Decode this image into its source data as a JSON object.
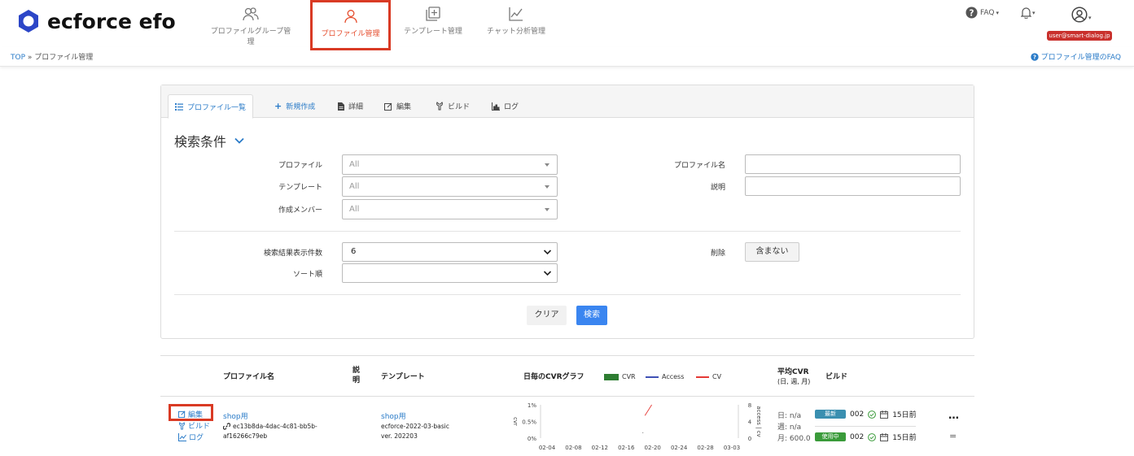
{
  "header": {
    "logo_text": "ecforce efo",
    "nav": [
      {
        "label": "プロファイルグループ管理",
        "active": false
      },
      {
        "label": "プロファイル管理",
        "active": true
      },
      {
        "label": "テンプレート管理",
        "active": false
      },
      {
        "label": "チャット分析管理",
        "active": false
      }
    ],
    "faq_label": "FAQ",
    "user_email": "user@smart-dialog.jp"
  },
  "breadcrumb": {
    "home": "TOP",
    "separator": "»",
    "current": "プロファイル管理"
  },
  "help_link": "プロファイル管理のFAQ",
  "tabs": [
    {
      "label": "プロファイル一覧",
      "icon": "list-icon",
      "active": true
    },
    {
      "label": "新規作成",
      "icon": "plus-icon",
      "active": false
    },
    {
      "label": "詳細",
      "icon": "document-icon",
      "active": false
    },
    {
      "label": "編集",
      "icon": "edit-icon",
      "active": false
    },
    {
      "label": "ビルド",
      "icon": "build-icon",
      "active": false
    },
    {
      "label": "ログ",
      "icon": "chart-icon",
      "active": false
    }
  ],
  "search": {
    "title": "検索条件",
    "fields": {
      "profile_label": "プロファイル",
      "profile_value": "All",
      "template_label": "テンプレート",
      "template_value": "All",
      "member_label": "作成メンバー",
      "member_value": "All",
      "profile_name_label": "プロファイル名",
      "profile_name_value": "",
      "description_label": "説明",
      "description_value": "",
      "count_label": "検索結果表示件数",
      "count_value": "6",
      "sort_label": "ソート順",
      "sort_value": "",
      "delete_label": "削除",
      "delete_value": "含まない"
    },
    "clear_label": "クリア",
    "search_label": "検索"
  },
  "table": {
    "headers": {
      "profile_name": "プロファイル名",
      "description": "説明",
      "template": "テンプレート",
      "graph": "日毎のCVRグラフ",
      "avg_cvr": "平均CVR",
      "avg_cvr_sub": "(日, 週, 月)",
      "build": "ビルド"
    },
    "legend": [
      {
        "name": "CVR",
        "color": "#2e7d32"
      },
      {
        "name": "Access",
        "color": "#3f51b5"
      },
      {
        "name": "CV",
        "color": "#e53935"
      }
    ],
    "rows": [
      {
        "actions": {
          "edit": "編集",
          "build": "ビルド",
          "log": "ログ"
        },
        "profile_name": "shop用",
        "profile_id_1": "ec13b8da-4dac-4c81-bb5b-",
        "profile_id_2": "af16266c79eb",
        "description": "",
        "template_name": "shop用",
        "template_id": "ecforce-2022-03-basic",
        "template_version": "ver. 202203",
        "avg_cvr": {
          "day": "日: n/a",
          "week": "週: n/a",
          "month": "月: 600.0"
        },
        "builds": [
          {
            "badge": "最新",
            "badge_color": "#3a8fb0",
            "number": "002",
            "date": "15日前"
          },
          {
            "badge": "使用中",
            "badge_color": "#3a9b3a",
            "number": "002",
            "date": "15日前"
          }
        ],
        "more": "…",
        "menu": "="
      }
    ]
  },
  "chart_data": {
    "type": "line",
    "x": [
      "02-04",
      "02-08",
      "02-12",
      "02-16",
      "02-20",
      "02-24",
      "02-28",
      "03-03"
    ],
    "yleft_ticks": [
      "1%",
      "0.5%",
      "0%"
    ],
    "yright_ticks": [
      "8",
      "4",
      "0"
    ],
    "ylabel_left": "cvr",
    "ylabel_right": "access | cv",
    "series": [
      {
        "name": "CV",
        "points": [
          [
            18.3,
            5.4
          ],
          [
            19.3,
            8.0
          ]
        ]
      }
    ],
    "xlim": [
      4,
      31
    ],
    "ylim_right": [
      0,
      8
    ]
  }
}
